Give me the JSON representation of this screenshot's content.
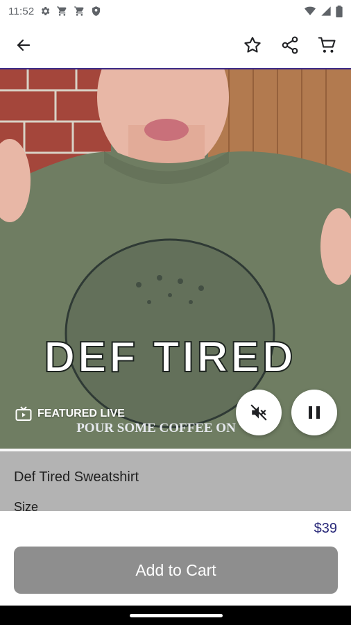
{
  "status_bar": {
    "time": "11:52",
    "icons": [
      "gear-icon",
      "cart-icon",
      "cart-icon",
      "shield-icon"
    ],
    "right_icons": [
      "wifi-icon",
      "signal-icon",
      "battery-icon"
    ]
  },
  "app_bar": {
    "back_icon": "arrow-left-icon",
    "actions": [
      "star-icon",
      "share-icon",
      "cart-icon"
    ]
  },
  "video": {
    "live_label": "FEATURED LIVE",
    "shirt_print": "DEF TIRED",
    "shirt_subprint": "POUR SOME COFFEE ON",
    "mute_icon": "volume-off-icon",
    "pause_icon": "pause-icon"
  },
  "product": {
    "title": "Def Tired Sweatshirt",
    "size_label": "Size",
    "price": "$39"
  },
  "cta": {
    "add_to_cart": "Add to Cart",
    "button_color": "#8e8e8e"
  },
  "colors": {
    "accent": "#3b2a86",
    "price": "#2a2a7a",
    "sheet": "#b3b3b3"
  }
}
